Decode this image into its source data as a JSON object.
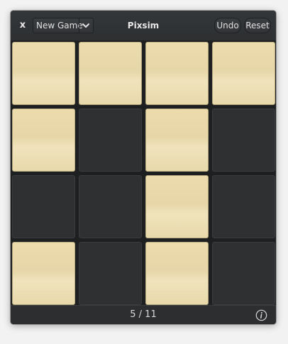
{
  "header": {
    "close_label": "x",
    "combo_label": "New Game",
    "title": "Pixsim",
    "undo_label": "Undo",
    "reset_label": "Reset"
  },
  "board": {
    "rows": 4,
    "cols": 4,
    "cells": [
      [
        1,
        1,
        1,
        1
      ],
      [
        1,
        0,
        1,
        0
      ],
      [
        0,
        0,
        1,
        0
      ],
      [
        1,
        0,
        1,
        0
      ]
    ]
  },
  "footer": {
    "counter": "5 / 11",
    "info_icon": "info-icon"
  },
  "colors": {
    "tile_on": "#eadcae",
    "tile_off": "#2e3032",
    "window_bg": "#2c2e30"
  }
}
